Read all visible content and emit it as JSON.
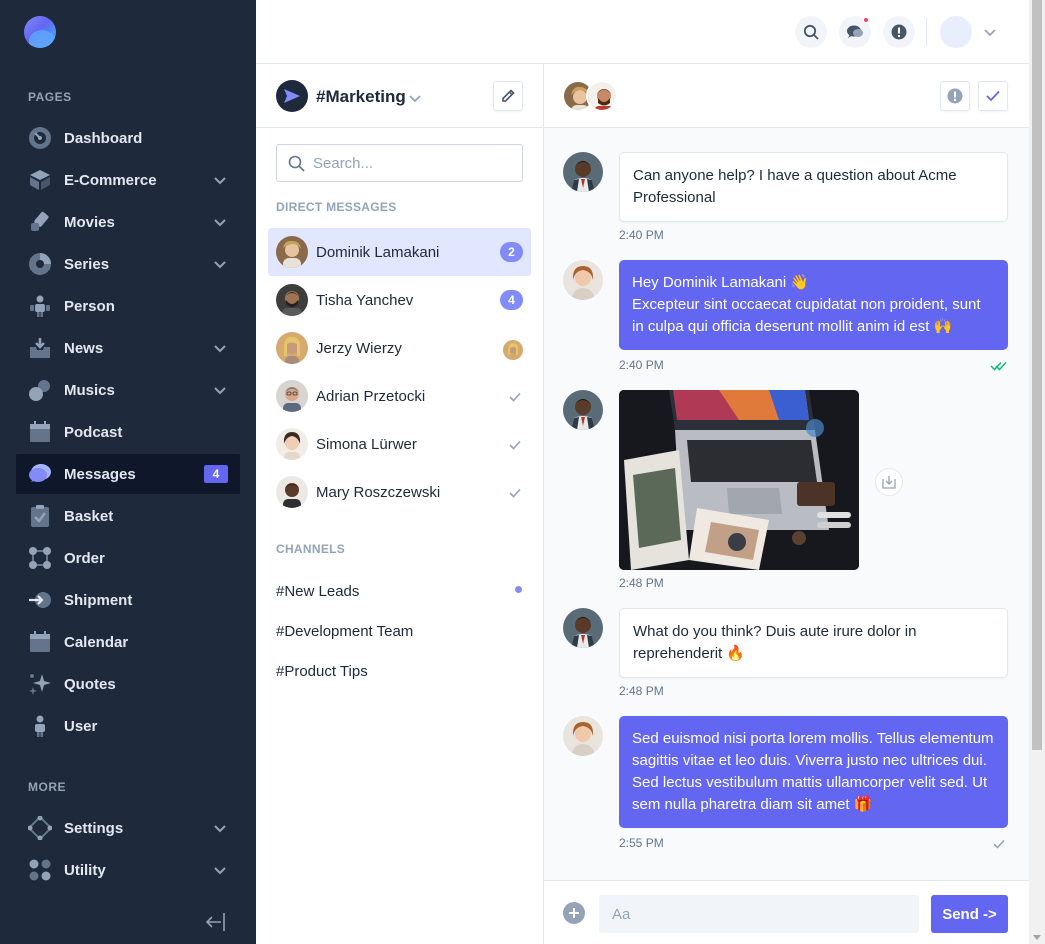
{
  "sidebar": {
    "sections": {
      "pages": "PAGES",
      "more": "MORE"
    },
    "items": [
      {
        "label": "Dashboard",
        "icon": "dashboard-icon"
      },
      {
        "label": "E-Commerce",
        "icon": "cube-icon"
      },
      {
        "label": "Movies",
        "icon": "ticket-icon"
      },
      {
        "label": "Series",
        "icon": "pie-icon"
      },
      {
        "label": "Person",
        "icon": "people-icon"
      },
      {
        "label": "News",
        "icon": "inbox-icon"
      },
      {
        "label": "Musics",
        "icon": "shapes-icon"
      },
      {
        "label": "Podcast",
        "icon": "calendar-icon"
      },
      {
        "label": "Messages",
        "icon": "chat-bubble-icon",
        "badge": "4"
      },
      {
        "label": "Basket",
        "icon": "clipboard-icon"
      },
      {
        "label": "Order",
        "icon": "nodes-icon"
      },
      {
        "label": "Shipment",
        "icon": "arrow-in-icon"
      },
      {
        "label": "Calendar",
        "icon": "calendar-icon"
      },
      {
        "label": "Quotes",
        "icon": "sparkles-icon"
      },
      {
        "label": "User",
        "icon": "person-icon"
      }
    ],
    "more_items": [
      {
        "label": "Settings",
        "icon": "settings-icon"
      },
      {
        "label": "Utility",
        "icon": "grid-dots-icon"
      }
    ]
  },
  "channel_panel": {
    "title": "#Marketing",
    "search_placeholder": "Search...",
    "dm_label": "DIRECT MESSAGES",
    "direct_messages": [
      {
        "name": "Dominik Lamakani",
        "badge": "2"
      },
      {
        "name": "Tisha Yanchev",
        "badge": "4"
      },
      {
        "name": "Jerzy Wierzy"
      },
      {
        "name": "Adrian Przetocki"
      },
      {
        "name": "Simona Lürwer"
      },
      {
        "name": "Mary Roszczewski"
      }
    ],
    "channels_label": "CHANNELS",
    "channels": [
      "#New Leads",
      "#Development Team",
      "#Product Tips"
    ]
  },
  "chat": {
    "messages": [
      {
        "text": "Can anyone help? I have a question about Acme Professional",
        "time": "2:40 PM"
      },
      {
        "line1": "Hey Dominik Lamakani 👋",
        "line2": "Excepteur sint occaecat cupidatat non proident, sunt in culpa qui officia deserunt mollit anim id est 🙌",
        "time": "2:40 PM"
      },
      {
        "time": "2:48 PM"
      },
      {
        "text": "What do you think? Duis aute irure dolor in reprehenderit 🔥",
        "time": "2:48 PM"
      },
      {
        "text": "Sed euismod nisi porta lorem mollis. Tellus elementum sagittis vitae et leo duis. Viverra justo nec ultrices dui. Sed lectus vestibulum mattis ullamcorper velit sed. Ut sem nulla pharetra diam sit amet 🎁",
        "time": "2:55 PM"
      }
    ],
    "composer_placeholder": "Aa",
    "send_label": "Send ->"
  },
  "colors": {
    "accent": "#6366f1",
    "sidebar_bg": "#1e293b",
    "success": "#10b981"
  }
}
